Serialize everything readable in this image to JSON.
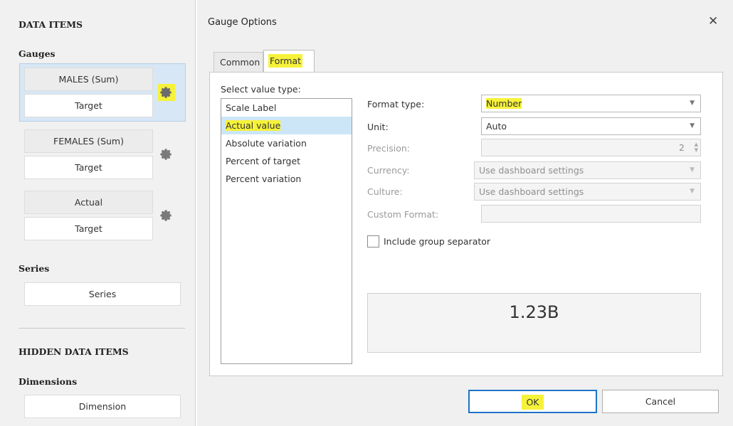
{
  "left": {
    "data_items_title": "DATA ITEMS",
    "gauges_title": "Gauges",
    "gauges": [
      {
        "actual": "MALES (Sum)",
        "target": "Target"
      },
      {
        "actual": "FEMALES (Sum)",
        "target": "Target"
      },
      {
        "actual": "Actual",
        "target": "Target"
      }
    ],
    "series_title": "Series",
    "series_item": "Series",
    "hidden_title": "HIDDEN DATA ITEMS",
    "dimensions_title": "Dimensions",
    "dimension_item": "Dimension"
  },
  "dialog": {
    "title": "Gauge Options",
    "close": "✕",
    "tabs": [
      "Common",
      "Format"
    ],
    "select_label": "Select value type:",
    "value_types": [
      "Scale Label",
      "Actual value",
      "Absolute variation",
      "Percent of target",
      "Percent variation"
    ],
    "selected_value_type": "Actual value",
    "format_type_label": "Format type:",
    "format_type_value": "Number",
    "unit_label": "Unit:",
    "unit_value": "Auto",
    "precision_label": "Precision:",
    "precision_value": "2",
    "currency_label": "Currency:",
    "currency_value": "Use dashboard settings",
    "culture_label": "Culture:",
    "culture_value": "Use dashboard settings",
    "custom_format_label": "Custom Format:",
    "custom_format_value": "",
    "group_separator_label": "Include group separator",
    "preview_value": "1.23B",
    "ok_label": "OK",
    "cancel_label": "Cancel"
  },
  "colors": {
    "highlight": "#f6f23a",
    "selected_item": "#cde6f7",
    "ok_border": "#1e73c8",
    "gauge_selected_bg": "#d7e7f5"
  }
}
